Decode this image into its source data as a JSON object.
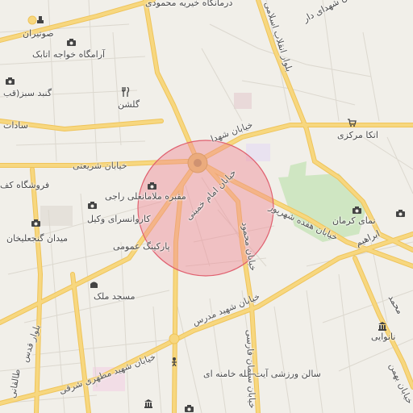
{
  "map": {
    "colors": {
      "background": "#f1efe9",
      "block_line": "#dcd8cf",
      "major_road": "#f7d77f",
      "major_road_casing": "#efc45a",
      "park": "#cfe6c2",
      "pink_area": "#e9d9d9",
      "highlight_fill": "#f08a95",
      "highlight_stroke": "#e0606f",
      "highlight_opacity": 0.45
    },
    "highlight": {
      "shape": "circle",
      "center_feature": "central-square"
    },
    "labels": {
      "darmangah": "درمانگاه خیریه محمودی",
      "shohada_top": "خیابان شهدای دار",
      "sotoran": "صوتیران",
      "aramgah": "آرامگاه خواجه اتابک",
      "gonbad": "گنبد سبز(قب",
      "sadat": "سادات",
      "golshan": "گلشن",
      "enghelab": "بلوار انقلاب اسلامی",
      "shohada_mid": "خیابان شهدا",
      "atka": "اتکا مرکزی",
      "shariati": "خیابان شریعتی",
      "forushgah": "فروشگاه کف",
      "maqbare": "مقبره ملامانعلی راجی",
      "karvansara": "کاروانسرای وکیل",
      "meydan": "میدان گنجعلیخان",
      "imam": "خیابان امام خمینی",
      "hefdah": "خیابان هفده شهریور",
      "namay": "نمای کرمان",
      "ebrahim": "ابراهیم",
      "parking": "پارکینگ عمومی",
      "masjed": "مسجد ملک",
      "mahmud": "خیابان محمود",
      "modarres": "خیابان شهید مدرس",
      "valiasr": "بلوار قدس",
      "nanvaei": "نانوایی",
      "mohammad": "محمد",
      "motahari": "خیابان شهید مطهری شرقی",
      "salon": "سالن ورزشی آیت الله خامنه ای",
      "shahid_right": "شهدای",
      "bahman": "خیابان بهمن",
      "tabl": "طالقانی",
      "sor": "خیابان سلمان فارسی"
    },
    "icons": [
      "camera-icon",
      "shopping-icon",
      "restaurant-icon",
      "mosque-icon",
      "bank-icon",
      "sport-icon",
      "monument-icon"
    ]
  }
}
